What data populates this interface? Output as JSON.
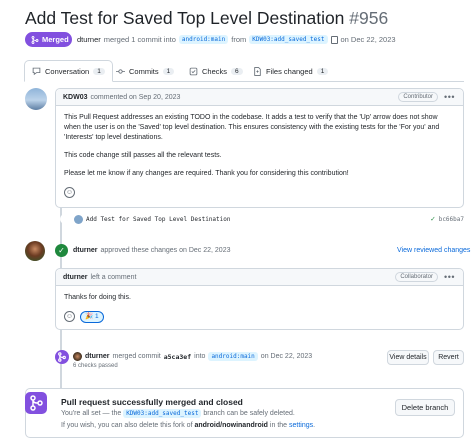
{
  "pr": {
    "title": "Add Test for Saved Top Level Destination",
    "number": "#956",
    "status": "Merged",
    "author": "dturner",
    "merged_text": "merged 1 commit into",
    "base_branch": "android:main",
    "from_text": "from",
    "head_branch": "KDW03:add_saved_test",
    "date_text": "on Dec 22, 2023"
  },
  "tabs": [
    {
      "label": "Conversation",
      "count": "1",
      "icon": "conversation-icon"
    },
    {
      "label": "Commits",
      "count": "1",
      "icon": "commit-icon"
    },
    {
      "label": "Checks",
      "count": "6",
      "icon": "checks-icon"
    },
    {
      "label": "Files changed",
      "count": "1",
      "icon": "file-diff-icon"
    }
  ],
  "comment1": {
    "author": "KDW03",
    "meta": "commented on Sep 20, 2023",
    "role": "Contributor",
    "paragraphs": [
      "This Pull Request addresses an existing TODO in the codebase. It adds a test to verify that the 'Up' arrow does not show when the user is on the 'Saved' top level destination. This ensures consistency with the existing tests for the 'For you' and 'Interests' top level destinations.",
      "This code change still passes all the relevant tests.",
      "Please let me know if any changes are required. Thank you for considering this contribution!"
    ]
  },
  "commit": {
    "message": "Add Test for Saved Top Level Destination",
    "sha": "bc66ba7",
    "check": "✓"
  },
  "approval": {
    "author": "dturner",
    "text": "approved these changes on Dec 22, 2023",
    "link": "View reviewed changes"
  },
  "comment2": {
    "author": "dturner",
    "meta": "left a comment",
    "role": "Collaborator",
    "body": "Thanks for doing this.",
    "reaction_emoji": "🎉",
    "reaction_count": "1"
  },
  "merge_event": {
    "author": "dturner",
    "text1": "merged commit",
    "sha": "a5ca3ef",
    "text2": "into",
    "branch": "android:main",
    "date": "on Dec 22, 2023",
    "checks": "6 checks passed",
    "view_details": "View details",
    "revert": "Revert"
  },
  "merge_box": {
    "title": "Pull request successfully merged and closed",
    "line1_a": "You're all set — the",
    "line1_branch": "KDW03:add_saved_test",
    "line1_b": "branch can be safely deleted.",
    "line2_a": "If you wish, you can also delete this fork of",
    "line2_repo": "android/nowinandroid",
    "line2_b": "in the",
    "line2_link": "settings",
    "delete_button": "Delete branch"
  },
  "colors": {
    "merged_purple": "#8250df",
    "approved_green": "#1f883d",
    "link_blue": "#0969da"
  }
}
